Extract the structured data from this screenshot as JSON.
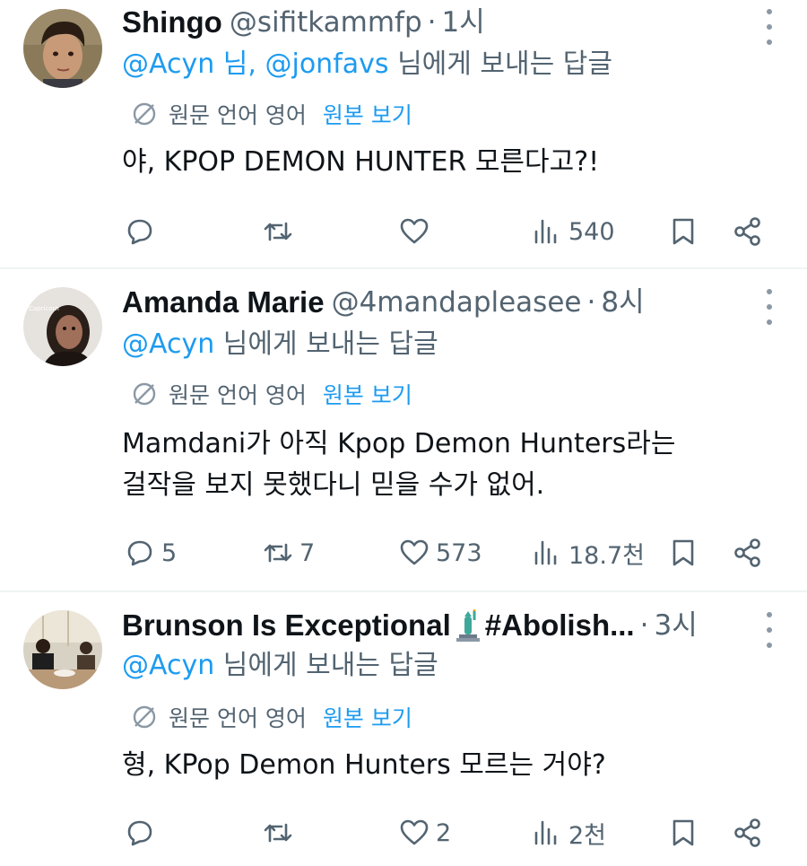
{
  "tweets": [
    {
      "author": {
        "display_name": "Shingo",
        "handle": "@sifitkammfp",
        "time": "1시",
        "avatar": "avatar-photo"
      },
      "reply_mentions": [
        "@Acyn 님,",
        "@jonfavs"
      ],
      "reply_suffix": " 님에게 보내는 답글",
      "translation": {
        "label": "원문 언어 영어",
        "link": "원본 보기"
      },
      "text": [
        "야, KPOP DEMON HUNTER 모른다고?!"
      ],
      "stats": {
        "replies": "",
        "reposts": "",
        "likes": "",
        "views": "540"
      }
    },
    {
      "author": {
        "display_name": "Amanda Marie",
        "handle": "@4mandapleasee",
        "time": "8시",
        "avatar": "avatar-photo",
        "avatar_text": "Capricorn"
      },
      "reply_mentions": [
        "@Acyn"
      ],
      "reply_suffix": " 님에게 보내는 답글",
      "translation": {
        "label": "원문 언어 영어",
        "link": "원본 보기"
      },
      "text": [
        "Mamdani가 아직 Kpop Demon Hunters라는",
        "걸작을 보지 못했다니 믿을 수가 없어."
      ],
      "stats": {
        "replies": "5",
        "reposts": "7",
        "likes": "573",
        "views": "18.7천"
      }
    },
    {
      "author": {
        "display_name": "Brunson Is Exceptional",
        "display_name_emoji": "statue-of-liberty-emoji",
        "display_name_suffix": "#Abolish...",
        "time": "3시",
        "avatar": "avatar-photo"
      },
      "reply_mentions": [
        "@Acyn"
      ],
      "reply_suffix": " 님에게 보내는 답글",
      "translation": {
        "label": "원문 언어 영어",
        "link": "원본 보기"
      },
      "text": [
        "형, KPop Demon Hunters 모르는 거야?"
      ],
      "stats": {
        "replies": "",
        "reposts": "",
        "likes": "2",
        "views": "2천"
      }
    }
  ],
  "dot_separator": "·",
  "icons": [
    "translate-icon",
    "reply-icon",
    "retweet-icon",
    "like-icon",
    "views-icon",
    "bookmark-icon",
    "share-icon",
    "more-icon"
  ],
  "colors": {
    "text": "#0f1419",
    "secondary": "#536471",
    "link": "#1d9bf0",
    "divider": "#eff3f4"
  }
}
